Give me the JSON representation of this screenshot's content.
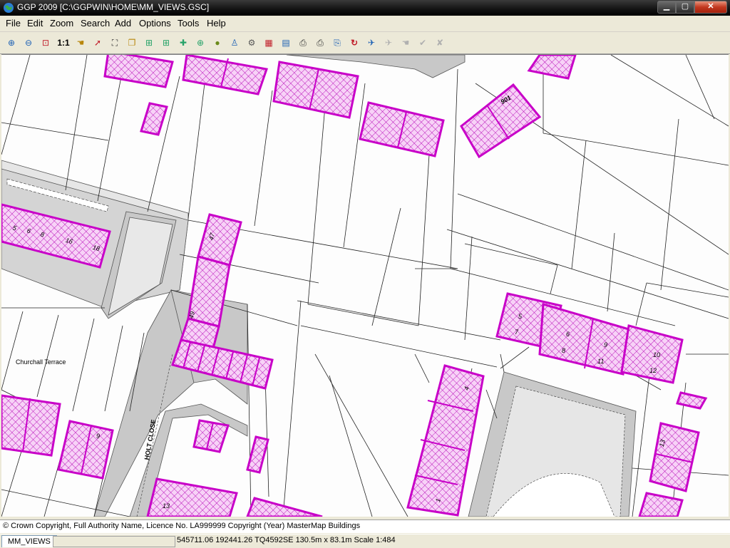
{
  "window": {
    "title": "GGP 2009 [C:\\GGPWIN\\HOME\\MM_VIEWS.GSC]",
    "controls": {
      "minimize": "▁",
      "maximize": "▢",
      "close": "✕"
    }
  },
  "menu": [
    "File",
    "Edit",
    "Zoom",
    "Search",
    "Add",
    "Options",
    "Tools",
    "Help"
  ],
  "toolbar": {
    "tools": [
      {
        "name": "zoom-in",
        "glyph": "⊕"
      },
      {
        "name": "zoom-out",
        "glyph": "⊖"
      },
      {
        "name": "zoom-window",
        "glyph": "⊡"
      },
      {
        "name": "zoom-1-1",
        "glyph": "1:1"
      },
      {
        "name": "pan",
        "glyph": "☚"
      },
      {
        "name": "select-arrow",
        "glyph": "➚"
      },
      {
        "name": "select-features",
        "glyph": "⛶"
      },
      {
        "name": "copy-layer",
        "glyph": "❐"
      },
      {
        "name": "add-layer",
        "glyph": "⊞"
      },
      {
        "name": "add-map",
        "glyph": "⊞"
      },
      {
        "name": "add-feature",
        "glyph": "✚"
      },
      {
        "name": "add-point",
        "glyph": "⊕"
      },
      {
        "name": "add-globe",
        "glyph": "●"
      },
      {
        "name": "search-person",
        "glyph": "♙"
      },
      {
        "name": "settings-gear",
        "glyph": "⚙"
      },
      {
        "name": "legend",
        "glyph": "▦"
      },
      {
        "name": "document",
        "glyph": "▤"
      },
      {
        "name": "print",
        "glyph": "⎙"
      },
      {
        "name": "print-setup",
        "glyph": "⎙"
      },
      {
        "name": "export",
        "glyph": "⎘"
      },
      {
        "name": "refresh",
        "glyph": "↻"
      },
      {
        "name": "edit-pointer",
        "glyph": "✈"
      },
      {
        "name": "edit-disabled-1",
        "glyph": "✈"
      },
      {
        "name": "edit-disabled-2",
        "glyph": "☚"
      },
      {
        "name": "accept",
        "glyph": "✔"
      },
      {
        "name": "cancel",
        "glyph": "✘"
      }
    ]
  },
  "map": {
    "labels": [
      {
        "text": "Churchall Terrace",
        "rotate": 0
      },
      {
        "text": "HOLT CLOSE",
        "rotate": -80
      },
      {
        "text": "901",
        "rotate": -30
      },
      {
        "text": "47",
        "rotate": -75
      },
      {
        "text": "49",
        "rotate": -75
      },
      {
        "text": "5",
        "rotate": 0
      },
      {
        "text": "7",
        "rotate": 0
      },
      {
        "text": "6",
        "rotate": 0
      },
      {
        "text": "8",
        "rotate": 0
      },
      {
        "text": "9",
        "rotate": 0
      },
      {
        "text": "11",
        "rotate": 0
      },
      {
        "text": "10",
        "rotate": 0
      },
      {
        "text": "12",
        "rotate": 0
      },
      {
        "text": "4",
        "rotate": -75
      },
      {
        "text": "1",
        "rotate": -75
      },
      {
        "text": "13",
        "rotate": -75
      },
      {
        "text": "9",
        "rotate": 0
      },
      {
        "text": "13",
        "rotate": 0
      },
      {
        "text": "5",
        "rotate": 15
      },
      {
        "text": "6",
        "rotate": 15
      },
      {
        "text": "8",
        "rotate": 15
      },
      {
        "text": "16",
        "rotate": 15
      },
      {
        "text": "18",
        "rotate": 15
      }
    ],
    "colors": {
      "building": "#cc00cc",
      "building_fill": "#f4c8f4",
      "road": "#c8c8c8",
      "paving": "#e6e6e6"
    }
  },
  "copyright": "© Crown Copyright, Full Authority Name, Licence No. LA999999 Copyright (Year) MasterMap Buildings",
  "status": {
    "view_tab": "MM_VIEWS",
    "coordinates": "545711.06 192441.26 TQ4592SE 130.5m x 83.1m Scale 1:484"
  }
}
